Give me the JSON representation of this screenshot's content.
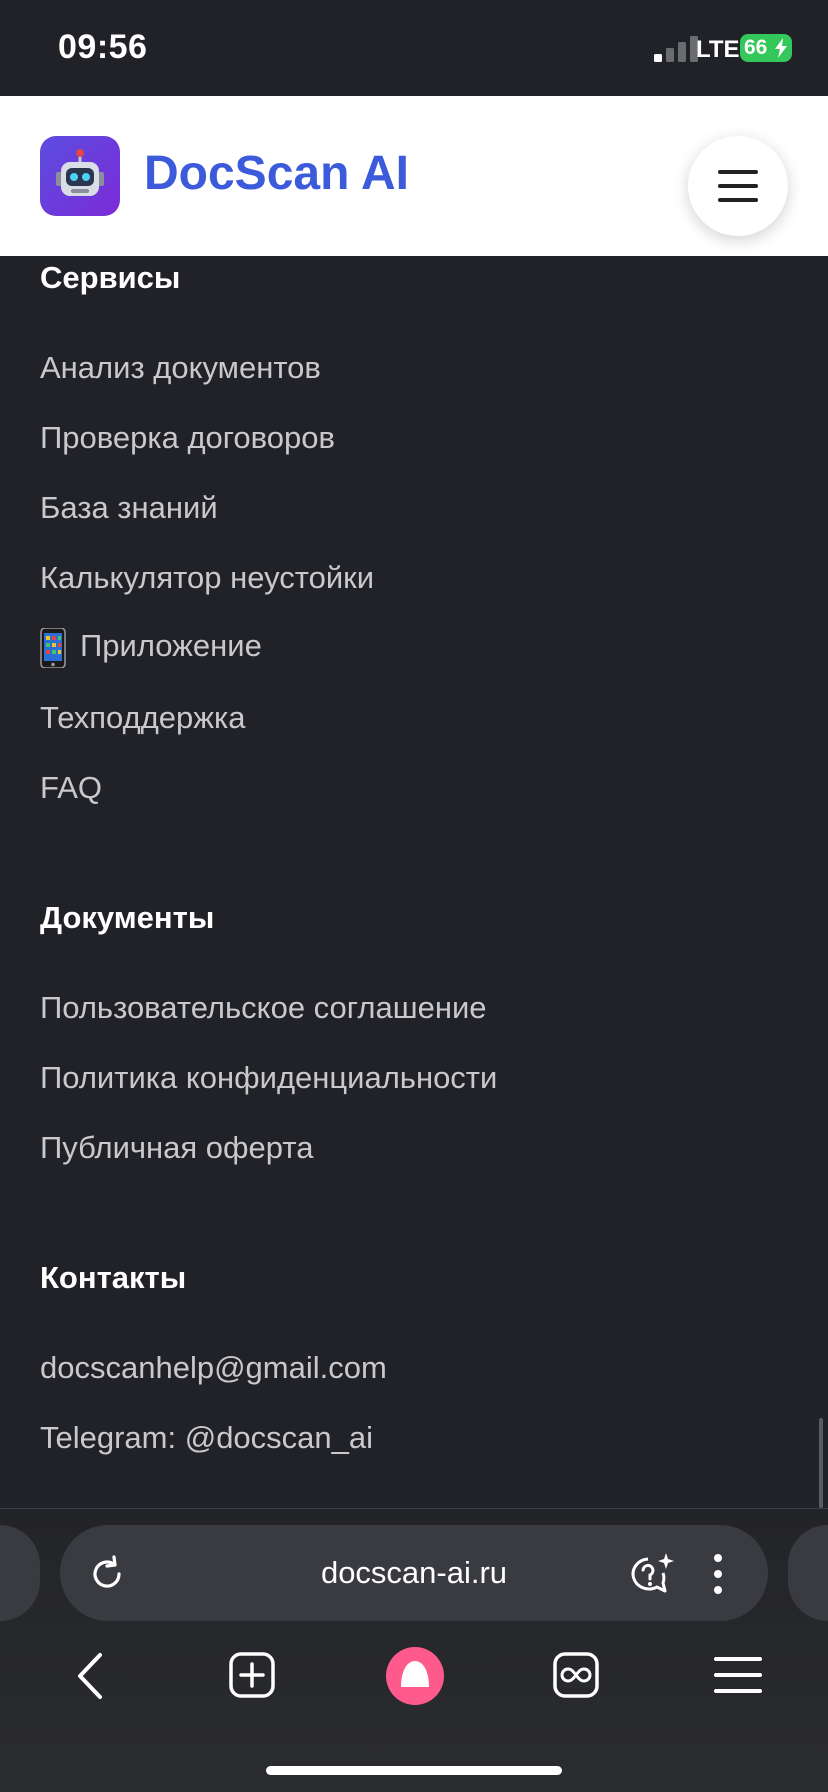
{
  "status_bar": {
    "time": "09:56",
    "network": "LTE",
    "battery": "66"
  },
  "header": {
    "brand": "DocScan AI",
    "logo_icon": "robot-icon",
    "menu_icon": "hamburger-icon"
  },
  "footer": {
    "services": {
      "title": "Сервисы",
      "links": [
        "Анализ документов",
        "Проверка договоров",
        "База знаний",
        "Калькулятор неустойки",
        "Приложение",
        "Техподдержка",
        "FAQ"
      ]
    },
    "documents": {
      "title": "Документы",
      "links": [
        "Пользовательское соглашение",
        "Политика конфиденциальности",
        "Публичная оферта"
      ]
    },
    "contacts": {
      "title": "Контакты",
      "email": "docscanhelp@gmail.com",
      "telegram": "Telegram: @docscan_ai"
    }
  },
  "browser": {
    "url": "docscan-ai.ru"
  },
  "colors": {
    "page_bg": "#212227",
    "brand": "#3b5bdb",
    "link": "#c9c9cc"
  }
}
